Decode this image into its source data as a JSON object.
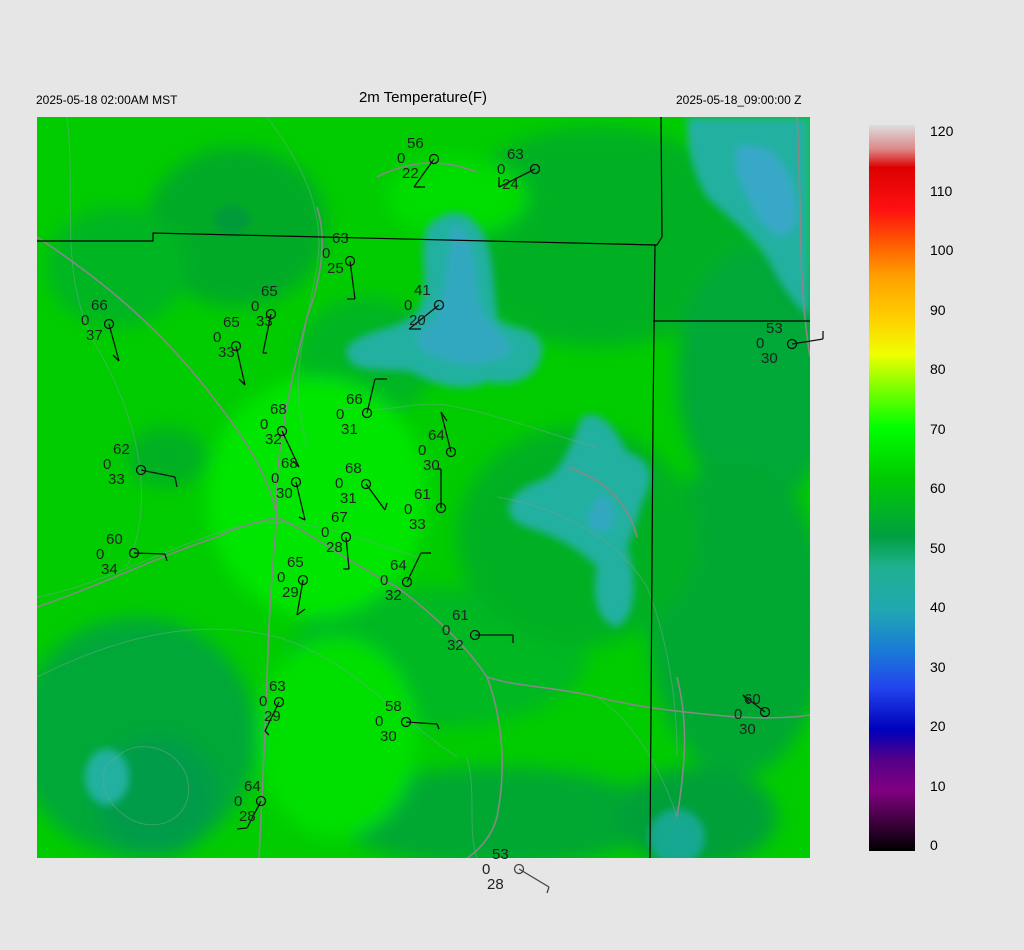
{
  "header": {
    "local_time": "2025-05-18 02:00AM MST",
    "title": "2m Temperature(F)",
    "utc_time": "2025-05-18_09:00:00 Z"
  },
  "colorbar": {
    "ticks": [
      "0",
      "10",
      "20",
      "30",
      "40",
      "50",
      "60",
      "70",
      "80",
      "90",
      "100",
      "110",
      "120"
    ],
    "stops": [
      [
        "0",
        "#000000"
      ],
      [
        "10",
        "#800080"
      ],
      [
        "15",
        "#550088"
      ],
      [
        "20",
        "#0000bb"
      ],
      [
        "27",
        "#2244ee"
      ],
      [
        "33",
        "#1a7ad8"
      ],
      [
        "40",
        "#20a8b0"
      ],
      [
        "47",
        "#20b090"
      ],
      [
        "52",
        "#00a040"
      ],
      [
        "62",
        "#00cc00"
      ],
      [
        "70",
        "#00ff00"
      ],
      [
        "77",
        "#88ff00"
      ],
      [
        "82",
        "#eeff00"
      ],
      [
        "88",
        "#ffd000"
      ],
      [
        "95",
        "#ffa000"
      ],
      [
        "100",
        "#ff6000"
      ],
      [
        "106",
        "#ff1010"
      ],
      [
        "113",
        "#dd0000"
      ],
      [
        "116",
        "#dd8888"
      ],
      [
        "120",
        "#dddddd"
      ]
    ]
  },
  "stations": [
    {
      "t": "56",
      "d": "22",
      "z": "0"
    },
    {
      "t": "63",
      "d": "24",
      "z": "0"
    },
    {
      "t": "63",
      "d": "25",
      "z": "0"
    },
    {
      "t": "41",
      "d": "20",
      "z": "0"
    },
    {
      "t": "66",
      "d": "37",
      "z": "0"
    },
    {
      "t": "65",
      "d": "33",
      "z": "0"
    },
    {
      "t": "65",
      "d": "33",
      "z": "0"
    },
    {
      "t": "53",
      "d": "30",
      "z": "0"
    },
    {
      "t": "66",
      "d": "31",
      "z": "0"
    },
    {
      "t": "68",
      "d": "32",
      "z": "0"
    },
    {
      "t": "64",
      "d": "30",
      "z": "0"
    },
    {
      "t": "62",
      "d": "33",
      "z": "0"
    },
    {
      "t": "68",
      "d": "30",
      "z": "0"
    },
    {
      "t": "68",
      "d": "31",
      "z": "0"
    },
    {
      "t": "61",
      "d": "33",
      "z": "0"
    },
    {
      "t": "67",
      "d": "28",
      "z": "0"
    },
    {
      "t": "60",
      "d": "34",
      "z": "0"
    },
    {
      "t": "65",
      "d": "29",
      "z": "0"
    },
    {
      "t": "64",
      "d": "32",
      "z": "0"
    },
    {
      "t": "61",
      "d": "32",
      "z": "0"
    },
    {
      "t": "63",
      "d": "29",
      "z": "0"
    },
    {
      "t": "58",
      "d": "30",
      "z": "0"
    },
    {
      "t": "60",
      "d": "30",
      "z": "0"
    },
    {
      "t": "64",
      "d": "28",
      "z": "0"
    },
    {
      "t": "53",
      "d": "28",
      "z": "0"
    }
  ]
}
